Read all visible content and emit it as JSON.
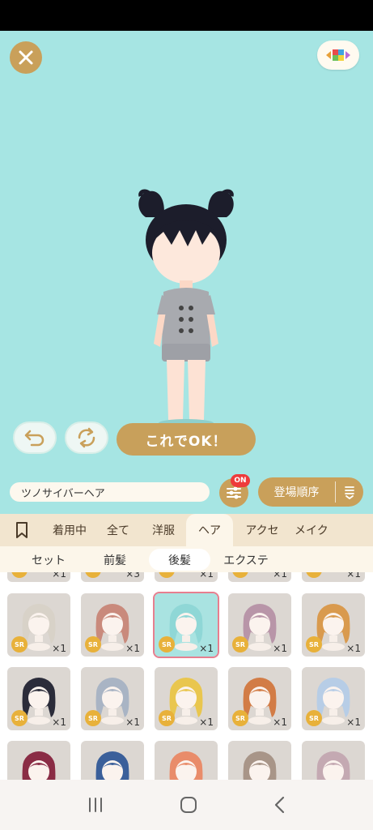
{
  "stage": {
    "ok_label": "これでOK！"
  },
  "toolbar": {
    "item_name": "ツノサイバーヘア",
    "filter_badge": "ON",
    "sort_label": "登場順序"
  },
  "tabs": [
    "着用中",
    "全て",
    "洋服",
    "ヘア",
    "アクセ",
    "メイク"
  ],
  "active_tab": "ヘア",
  "subtabs": [
    "セット",
    "前髪",
    "後髪",
    "エクステ"
  ],
  "active_subtab": "後髪",
  "top_partial_row": [
    "×1",
    "×3",
    "×1",
    "×1",
    "×1"
  ],
  "items": [
    {
      "rarity": "SR",
      "count": "×1",
      "hair": "#d8d2c8"
    },
    {
      "rarity": "SR",
      "count": "×1",
      "hair": "#c98a7c"
    },
    {
      "rarity": "SR",
      "count": "×1",
      "hair": "#8fd7d6",
      "selected": true
    },
    {
      "rarity": "SR",
      "count": "×1",
      "hair": "#b895a8"
    },
    {
      "rarity": "SR",
      "count": "×1",
      "hair": "#d99a4e"
    },
    {
      "rarity": "SR",
      "count": "×1",
      "hair": "#2b2c3a"
    },
    {
      "rarity": "SR",
      "count": "×1",
      "hair": "#a9b4c4"
    },
    {
      "rarity": "SR",
      "count": "×1",
      "hair": "#e9c64e"
    },
    {
      "rarity": "SR",
      "count": "×1",
      "hair": "#d27c46"
    },
    {
      "rarity": "SR",
      "count": "×1",
      "hair": "#b7cde6"
    },
    {
      "rarity": "",
      "count": "",
      "hair": "#8a2c45"
    },
    {
      "rarity": "",
      "count": "",
      "hair": "#3a5f9a"
    },
    {
      "rarity": "",
      "count": "",
      "hair": "#e98c6a"
    },
    {
      "rarity": "",
      "count": "",
      "hair": "#a89588"
    },
    {
      "rarity": "",
      "count": "",
      "hair": "#c4a9b2"
    }
  ],
  "colors": {
    "stage_bg": "#a6e5e3",
    "gold": "#c9a05a",
    "tab_bg": "#f2e5cf",
    "selected_outline": "#e77f8f"
  },
  "icons": [
    "close-icon",
    "palette-icon",
    "undo-icon",
    "rotate-icon",
    "filter-icon",
    "sort-icon",
    "bookmark-icon",
    "recents-icon",
    "home-icon",
    "back-icon"
  ]
}
